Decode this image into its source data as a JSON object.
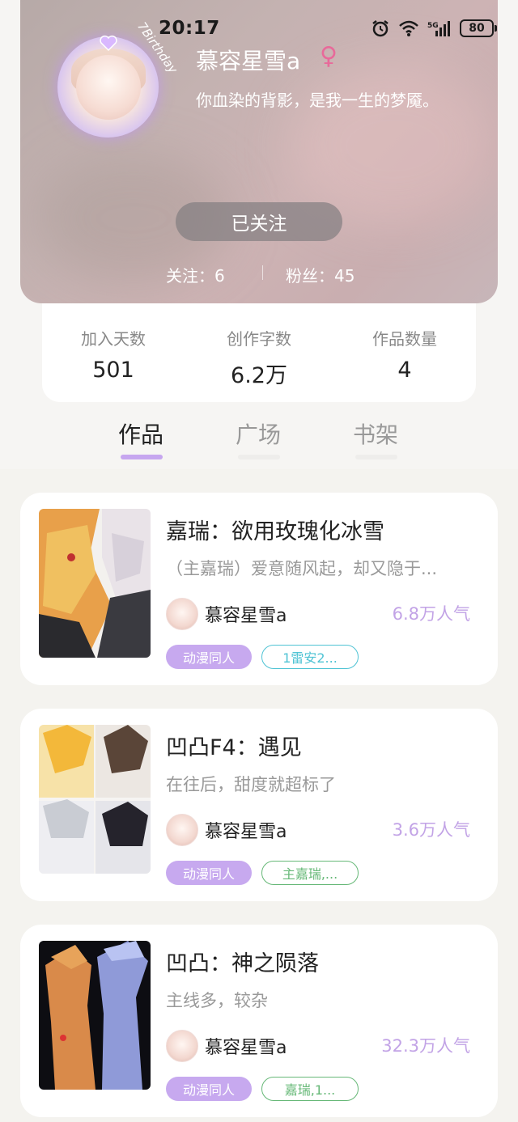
{
  "status_bar": {
    "time": "20:17",
    "battery": "80",
    "network": "5G"
  },
  "profile": {
    "avatar_text": "7Birthday",
    "username": "慕容星雪a",
    "gender_symbol": "♀",
    "bio": "你血染的背影，是我一生的梦魇。",
    "follow_button": "已关注",
    "following_label": "关注：6",
    "followers_label": "粉丝：45"
  },
  "stats": [
    {
      "label": "加入天数",
      "value": "501"
    },
    {
      "label": "创作字数",
      "value": "6.2万"
    },
    {
      "label": "作品数量",
      "value": "4"
    }
  ],
  "tabs": [
    {
      "label": "作品",
      "active": true
    },
    {
      "label": "广场",
      "active": false
    },
    {
      "label": "书架",
      "active": false
    }
  ],
  "works": [
    {
      "title": "嘉瑞：欲用玫瑰化冰雪",
      "description": "（主嘉瑞）爱意随风起，却又隐于...",
      "author": "慕容星雪a",
      "popularity": "6.8万人气",
      "tag_category": "动漫同人",
      "tag_cp": "1雷安2...",
      "tag_cp_color": "#4fc3d4"
    },
    {
      "title": "凹凸F4：遇见",
      "description": "在往后，甜度就超标了",
      "author": "慕容星雪a",
      "popularity": "3.6万人气",
      "tag_category": "动漫同人",
      "tag_cp": "主嘉瑞,...",
      "tag_cp_color": "#66b877"
    },
    {
      "title": "凹凸：神之陨落",
      "description": "主线多，较杂",
      "author": "慕容星雪a",
      "popularity": "32.3万人气",
      "tag_category": "动漫同人",
      "tag_cp": "嘉瑞,1...",
      "tag_cp_color": "#66b877"
    }
  ],
  "colors": {
    "accent": "#c6a6ef",
    "gender": "#e86a9a"
  }
}
